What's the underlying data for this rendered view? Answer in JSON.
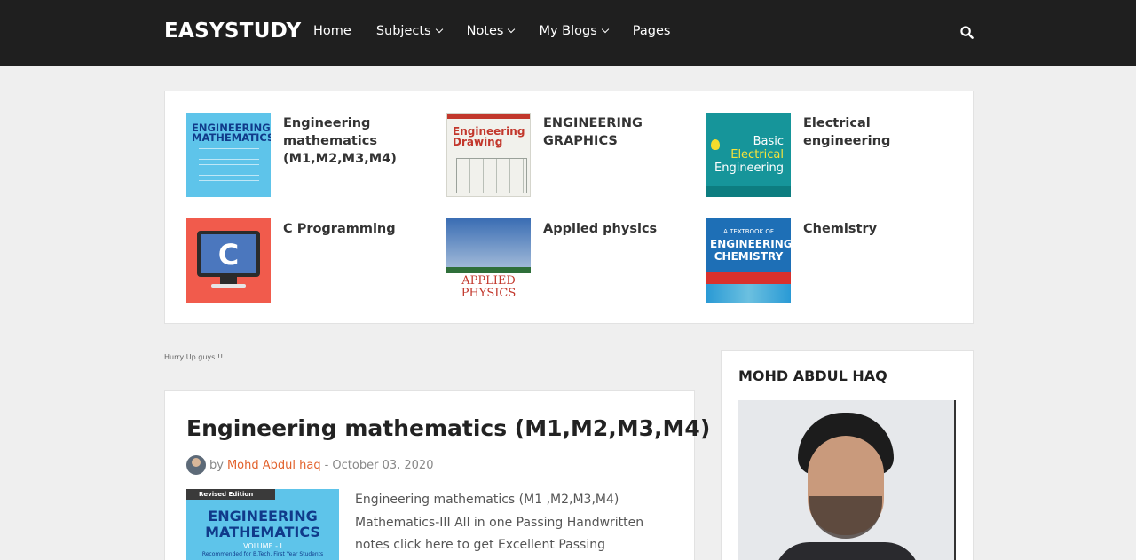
{
  "navbar": {
    "brand": "EASYSTUDY",
    "items": [
      {
        "label": "Home",
        "dropdown": false
      },
      {
        "label": "Subjects",
        "dropdown": true
      },
      {
        "label": "Notes",
        "dropdown": true
      },
      {
        "label": "My Blogs",
        "dropdown": true
      },
      {
        "label": "Pages",
        "dropdown": false
      }
    ],
    "search_icon": "search-icon"
  },
  "featured": [
    {
      "title": "Engineering mathematics (M1,M2,M3,M4)",
      "thumb": {
        "line1": "ENGINEERING",
        "line2": "MATHEMATICS"
      }
    },
    {
      "title": "ENGINEERING GRAPHICS",
      "thumb": {
        "line1": "Engineering",
        "line2": "Drawing"
      }
    },
    {
      "title": "Electrical engineering",
      "thumb": {
        "line1": "Basic",
        "line2": "Electrical",
        "line3": "Engineering"
      }
    },
    {
      "title": "C Programming",
      "thumb": {
        "letter": "C"
      }
    },
    {
      "title": "Applied physics",
      "thumb": {
        "line1": "APPLIED",
        "line2": "PHYSICS"
      }
    },
    {
      "title": "Chemistry",
      "thumb": {
        "line1": "A TEXTBOOK OF",
        "line2": "ENGINEERING",
        "line3": "CHEMISTRY"
      }
    }
  ],
  "hurry_text": "Hurry Up guys !!",
  "post": {
    "title": "Engineering mathematics (M1,M2,M3,M4)",
    "by": "by",
    "author": "Mohd Abdul haq",
    "date": "- October 03, 2020",
    "thumb": {
      "edition": "Revised Edition",
      "line1": "ENGINEERING",
      "line2": "MATHEMATICS",
      "volume": "VOLUME - I",
      "note": "Recommended for B.Tech. First Year Students"
    },
    "excerpt": "Engineering mathematics (M1 ,M2,M3,M4) Mathematics-III All in one Passing Handwritten notes click here to get Excellent Passing Handwritten notes"
  },
  "sidebar": {
    "title": "MOHD ABDUL HAQ"
  }
}
